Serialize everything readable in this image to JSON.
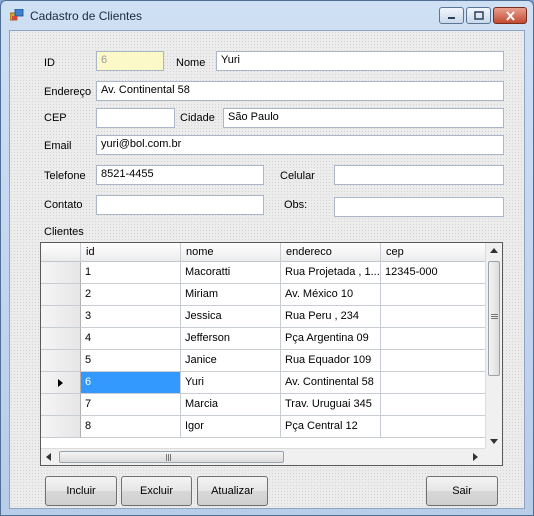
{
  "window": {
    "title": "Cadastro de Clientes"
  },
  "form": {
    "id_label": "ID",
    "id_value": "6",
    "nome_label": "Nome",
    "nome_value": "Yuri",
    "endereco_label": "Endereço",
    "endereco_value": "Av.  Continental 58",
    "cep_label": "CEP",
    "cep_value": "",
    "cidade_label": "Cidade",
    "cidade_value": "São Paulo",
    "email_label": "Email",
    "email_value": "yuri@bol.com.br",
    "telefone_label": "Telefone",
    "telefone_value": "8521-4455",
    "celular_label": "Celular",
    "celular_value": "",
    "contato_label": "Contato",
    "contato_value": "",
    "obs_label": "Obs:",
    "obs_value": ""
  },
  "grid": {
    "caption": "Clientes",
    "columns": [
      "id",
      "nome",
      "endereco",
      "cep"
    ],
    "rows": [
      {
        "id": "1",
        "nome": "Macoratti",
        "endereco": "Rua Projetada , 1...",
        "cep": "12345-000"
      },
      {
        "id": "2",
        "nome": "Miriam",
        "endereco": "Av. México 10",
        "cep": ""
      },
      {
        "id": "3",
        "nome": "Jessica",
        "endereco": "Rua Peru , 234",
        "cep": ""
      },
      {
        "id": "4",
        "nome": "Jefferson",
        "endereco": "Pça Argentina 09",
        "cep": ""
      },
      {
        "id": "5",
        "nome": "Janice",
        "endereco": "Rua Equador 109",
        "cep": ""
      },
      {
        "id": "6",
        "nome": "Yuri",
        "endereco": "Av.  Continental 58",
        "cep": ""
      },
      {
        "id": "7",
        "nome": "Marcia",
        "endereco": "Trav.  Uruguai 345",
        "cep": ""
      },
      {
        "id": "8",
        "nome": "Igor",
        "endereco": "Pça Central 12",
        "cep": ""
      }
    ],
    "selected_row": 5
  },
  "buttons": {
    "incluir": "Incluir",
    "excluir": "Excluir",
    "atualizar": "Atualizar",
    "sair": "Sair"
  },
  "colors": {
    "selection": "#3399ff",
    "id_field_bg": "#fbf9c8"
  }
}
